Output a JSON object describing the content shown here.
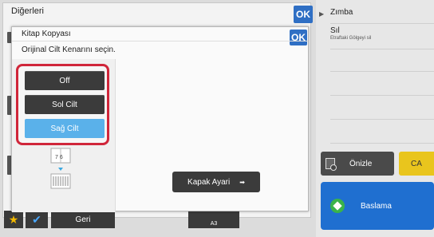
{
  "background_panel": {
    "title": "Diğerleri",
    "ok_label": "OK"
  },
  "right_panel": {
    "items": [
      {
        "title": "Zımba",
        "subtitle": ""
      },
      {
        "title": "Sıl",
        "subtitle": "Etraftaki Gölgeyi sil"
      }
    ],
    "preview_label": "Önizle",
    "ca_label": "CA",
    "start_label": "Baslama"
  },
  "bottom_bar": {
    "back_label": "Geri",
    "paper_size": "A3"
  },
  "modal": {
    "title": "Kitap Kopyası",
    "ok_label": "OK",
    "instruction": "Orijinal Cilt Kenarını seçin.",
    "options": [
      {
        "label": "Off",
        "selected": false
      },
      {
        "label": "Sol Cilt",
        "selected": false
      },
      {
        "label": "Sağ Cilt",
        "selected": true
      }
    ],
    "book_icon_pages": "7 6",
    "cover_button_label": "Kapak Ayari"
  },
  "colors": {
    "accent": "#2f6fc4",
    "selected": "#5ab1ea",
    "highlight": "#d0263a",
    "ca": "#e9c51d",
    "start": "#1f6fd0"
  },
  "icons": [
    "star-icon",
    "check-icon",
    "preview-icon",
    "start-icon",
    "arrow-right-icon",
    "book-icon"
  ]
}
